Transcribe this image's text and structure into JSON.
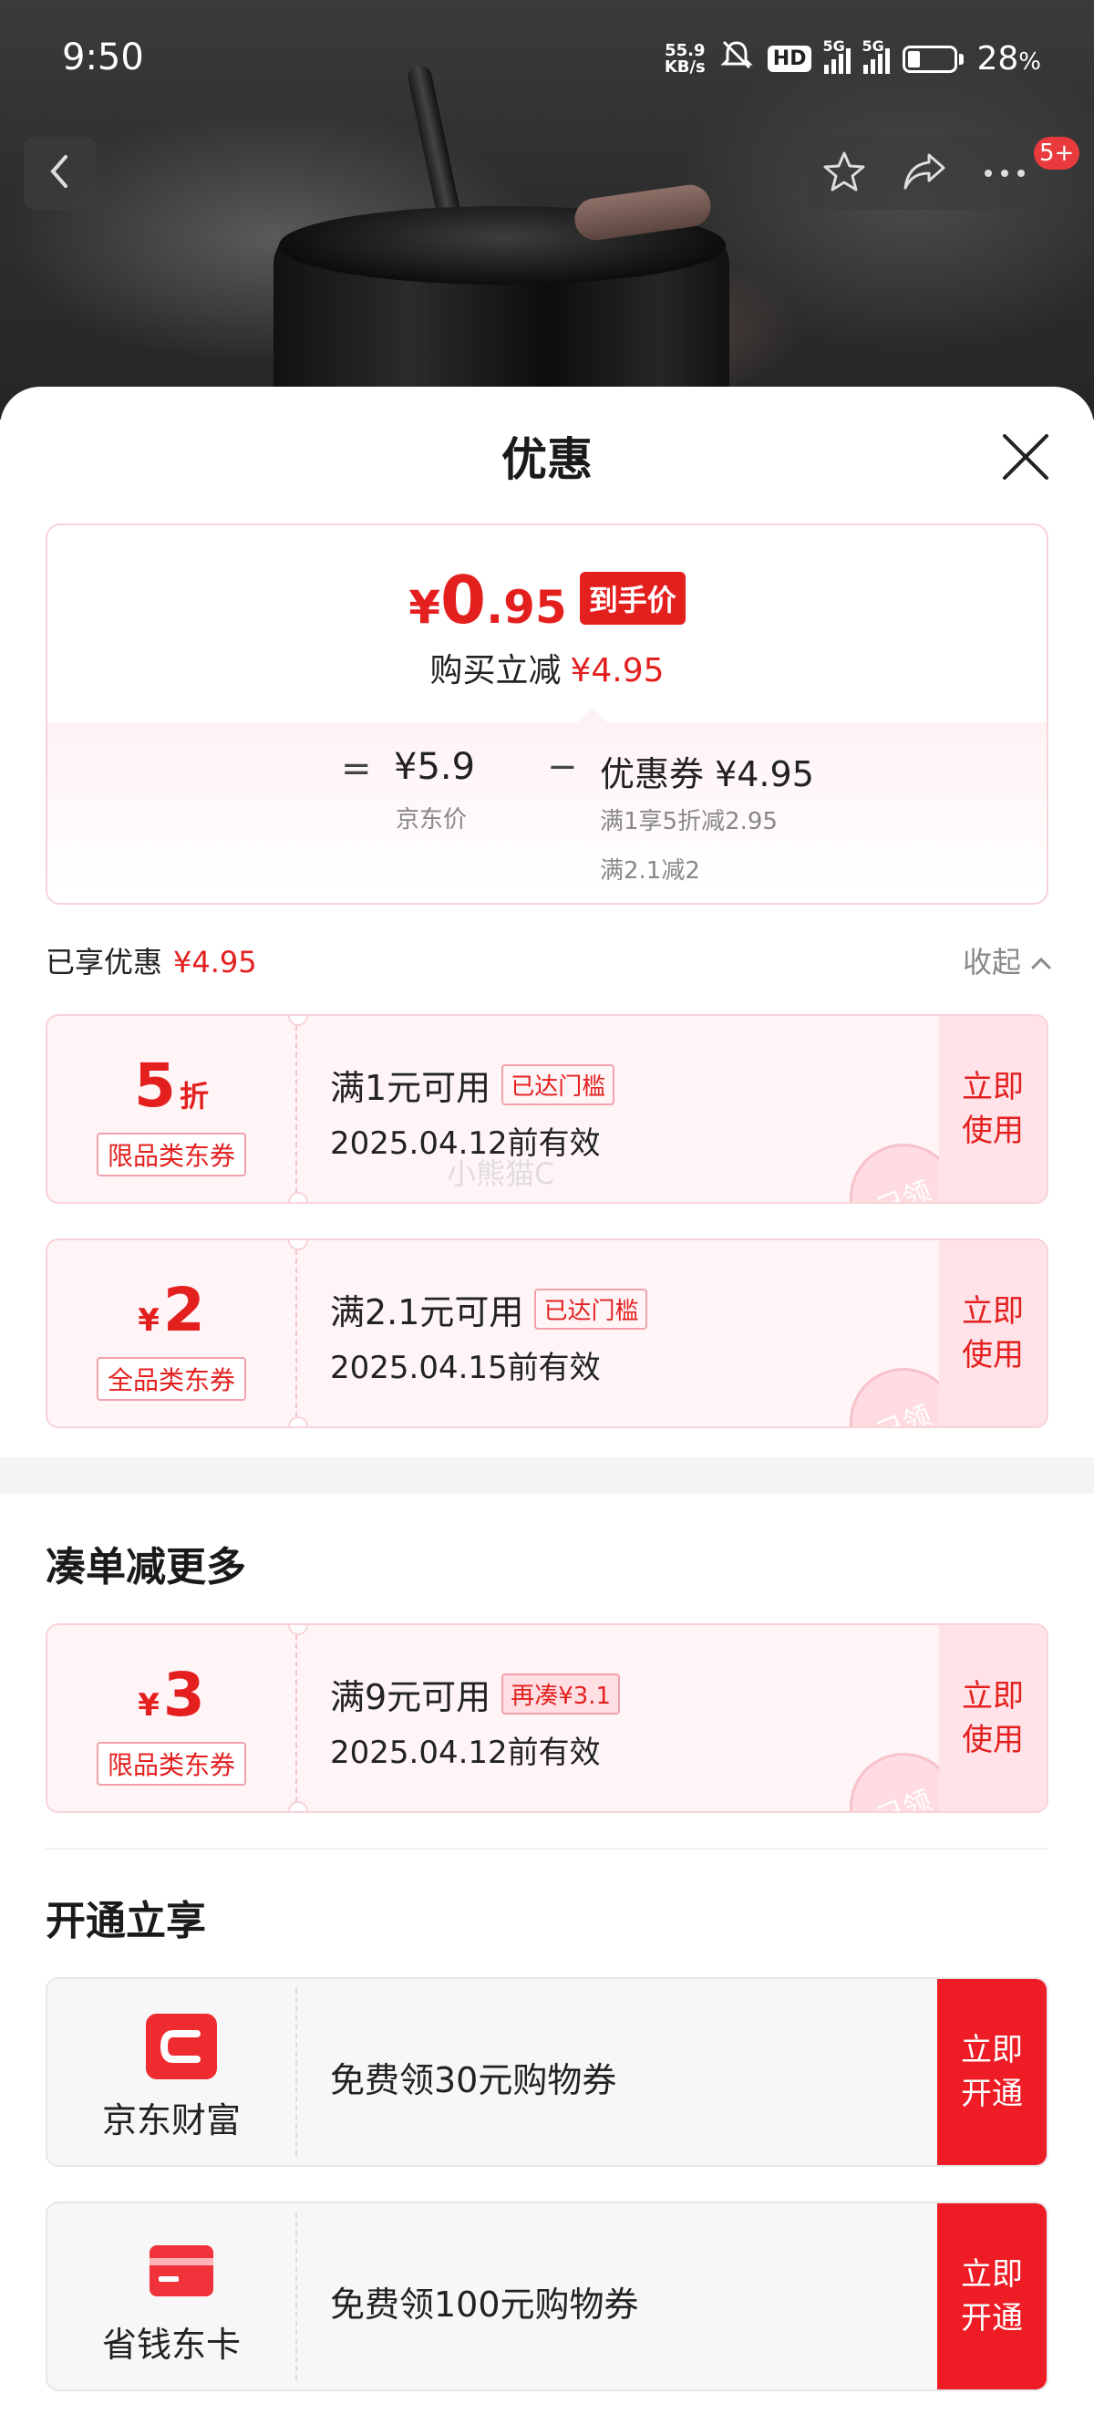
{
  "status_bar": {
    "time": "9:50",
    "net_speed_value": "55.9",
    "net_speed_unit": "KB/s",
    "hd_badge": "HD",
    "network_1": "5G",
    "network_2": "5G",
    "battery_percent": "28",
    "battery_suffix": "%",
    "battery_level": 0.28
  },
  "nav": {
    "back_icon": "chevron-left-icon",
    "favorite_icon": "star-icon",
    "share_icon": "share-icon",
    "more_icon": "more-dots-icon",
    "message_badge": "5+"
  },
  "sheet": {
    "title": "优惠",
    "close_icon": "close-icon"
  },
  "price_summary": {
    "currency": "¥",
    "final_integer": "0",
    "final_decimal": ".95",
    "final_tag": "到手价",
    "reduce_label": "购买立减",
    "reduce_amount": "¥4.95",
    "equals_sign": "=",
    "jd_price": "¥5.9",
    "jd_price_label": "京东价",
    "minus_sign": "−",
    "coupon_total": "优惠券 ¥4.95",
    "coupon_rules": [
      "满1享5折减2.95",
      "满2.1减2"
    ]
  },
  "enjoyed": {
    "label": "已享优惠",
    "amount": "¥4.95",
    "collapse_label": "收起",
    "collapse_icon": "chevron-up-icon"
  },
  "coupons": [
    {
      "amount": "5",
      "unit": "折",
      "type": "限品类东券",
      "condition": "满1元可用",
      "condition_tag": "已达门槛",
      "validity": "2025.04.12前有效",
      "button": "立即使用",
      "stamp": "已领"
    },
    {
      "currency": "¥",
      "amount": "2",
      "type": "全品类东券",
      "condition": "满2.1元可用",
      "condition_tag": "已达门槛",
      "validity": "2025.04.15前有效",
      "button": "立即使用",
      "stamp": "已领"
    }
  ],
  "watermark": "小熊猫C",
  "more_section": {
    "title": "凑单减更多",
    "coupons": [
      {
        "currency": "¥",
        "amount": "3",
        "type": "限品类东券",
        "condition": "满9元可用",
        "condition_tag": "再凑¥3.1",
        "validity": "2025.04.12前有效",
        "button": "立即使用",
        "stamp": "已领"
      }
    ]
  },
  "open_section": {
    "title": "开通立享",
    "cards": [
      {
        "brand": "京东财富",
        "icon": "jd-wealth-icon",
        "offer": "免费领30元购物券",
        "button": "立即开通"
      },
      {
        "brand": "省钱东卡",
        "icon": "card-icon",
        "offer": "免费领100元购物券",
        "button": "立即开通"
      }
    ]
  },
  "colors": {
    "accent_red": "#e4201f",
    "button_red": "#ee1c25",
    "coupon_bg": "#fff5f7",
    "coupon_border": "#f8d3d8"
  }
}
